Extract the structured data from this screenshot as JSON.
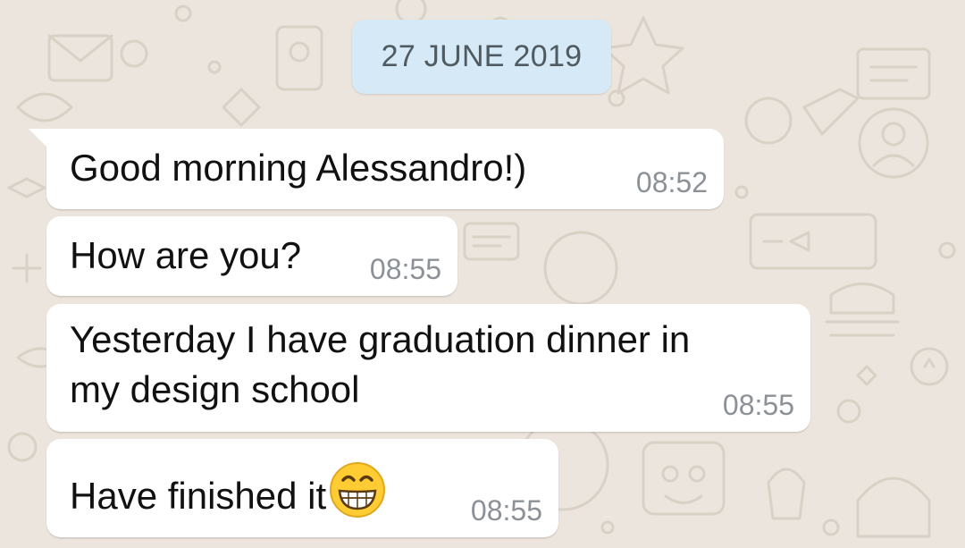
{
  "chat": {
    "date_chip": "27 JUNE 2019",
    "messages": [
      {
        "text": "Good morning Alessandro!)",
        "time": "08:52"
      },
      {
        "text": "How are you?",
        "time": "08:55"
      },
      {
        "text": "Yesterday I have graduation dinner in\nmy design school",
        "time": "08:55"
      },
      {
        "text": "Have finished it",
        "emoji": "grinning-face-icon",
        "time": "08:55"
      }
    ]
  },
  "colors": {
    "wallpaper": "#ece5dd",
    "wallpaper_doodle": "#d9d1c5",
    "date_chip_bg": "#d5eaf6",
    "bubble_bg": "#ffffff",
    "timestamp": "#8b9196",
    "emoji_face": "#ffcc33"
  }
}
